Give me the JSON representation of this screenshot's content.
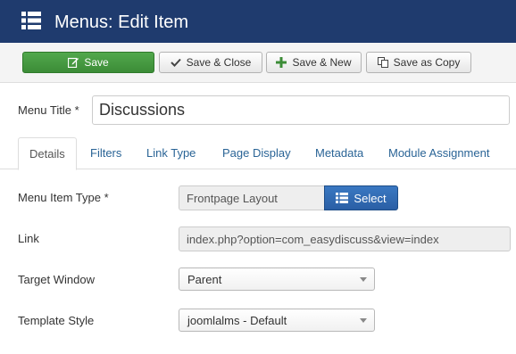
{
  "header": {
    "title": "Menus: Edit Item",
    "icon": "list-icon"
  },
  "toolbar": {
    "save_label": "Save",
    "save_close_label": "Save & Close",
    "save_new_label": "Save & New",
    "save_copy_label": "Save as Copy"
  },
  "form": {
    "menu_title_label": "Menu Title",
    "menu_title_value": "Discussions",
    "required_mark": "*"
  },
  "tabs": [
    {
      "label": "Details",
      "active": true
    },
    {
      "label": "Filters"
    },
    {
      "label": "Link Type"
    },
    {
      "label": "Page Display"
    },
    {
      "label": "Metadata"
    },
    {
      "label": "Module Assignment"
    }
  ],
  "details": {
    "menu_item_type_label": "Menu Item Type",
    "menu_item_type_value": "Frontpage Layout",
    "select_label": "Select",
    "link_label": "Link",
    "link_value": "index.php?option=com_easydiscuss&view=index",
    "target_window_label": "Target Window",
    "target_window_value": "Parent",
    "template_style_label": "Template Style",
    "template_style_value": "joomlalms - Default"
  },
  "colors": {
    "header_bg": "#1f3b6e",
    "save_green": "#3c8c37",
    "select_blue": "#2a5fa5",
    "link_blue": "#2a6496"
  }
}
